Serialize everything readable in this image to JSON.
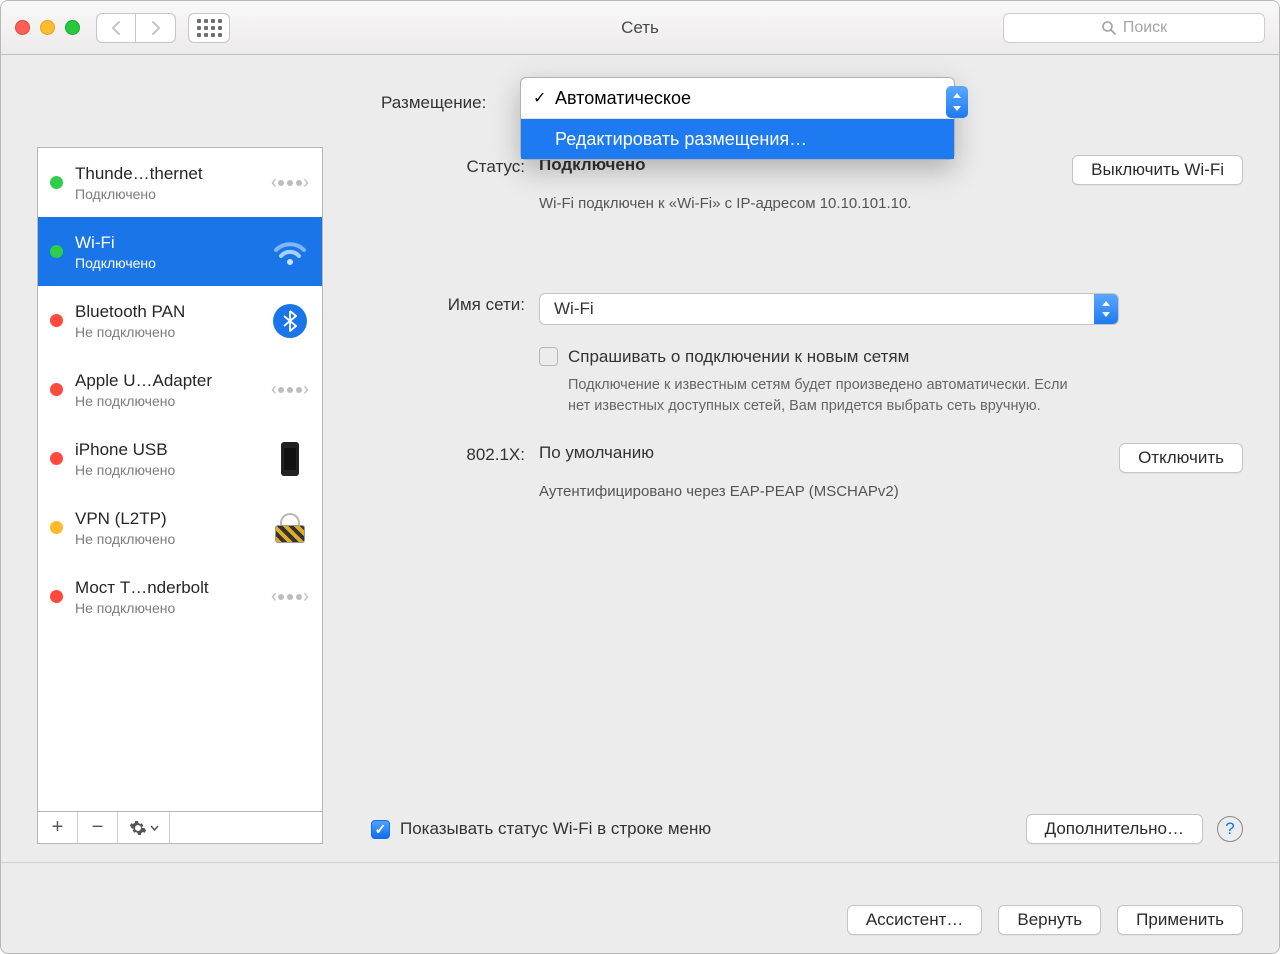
{
  "window": {
    "title": "Сеть"
  },
  "search": {
    "placeholder": "Поиск"
  },
  "location": {
    "label": "Размещение:",
    "options": {
      "auto": "Автоматическое",
      "edit": "Редактировать размещения…"
    }
  },
  "sidebar": {
    "items": [
      {
        "name": "Thunde…thernet",
        "status": "Подключено",
        "dot": "g",
        "icon": "ethernet"
      },
      {
        "name": "Wi-Fi",
        "status": "Подключено",
        "dot": "g",
        "icon": "wifi"
      },
      {
        "name": "Bluetooth PAN",
        "status": "Не подключено",
        "dot": "r",
        "icon": "bt"
      },
      {
        "name": "Apple U…Adapter",
        "status": "Не подключено",
        "dot": "r",
        "icon": "ethernet"
      },
      {
        "name": "iPhone USB",
        "status": "Не подключено",
        "dot": "r",
        "icon": "phone"
      },
      {
        "name": "VPN (L2TP)",
        "status": "Не подключено",
        "dot": "o",
        "icon": "lock"
      },
      {
        "name": "Мост T…nderbolt",
        "status": "Не подключено",
        "dot": "r",
        "icon": "ethernet"
      }
    ]
  },
  "detail": {
    "status_label": "Статус:",
    "status_value": "Подключено",
    "status_sub": "Wi-Fi подключен к «Wi-Fi» с IP-адресом 10.10.101.10.",
    "wifi_off_btn": "Выключить Wi-Fi",
    "network_label": "Имя сети:",
    "network_value": "Wi-Fi",
    "ask_new": "Спрашивать о подключении к новым сетям",
    "ask_new_hint": "Подключение к известным сетям будет произведено автоматически. Если нет известных доступных сетей, Вам придется выбрать сеть вручную.",
    "dot1x_label": "802.1X:",
    "dot1x_value": "По умолчанию",
    "dot1x_sub": "Аутентифицировано через EAP-PEAP (MSCHAPv2)",
    "disconnect_btn": "Отключить",
    "show_menubar": "Показывать статус Wi-Fi в строке меню",
    "advanced_btn": "Дополнительно…"
  },
  "footer": {
    "assist": "Ассистент…",
    "revert": "Вернуть",
    "apply": "Применить"
  }
}
